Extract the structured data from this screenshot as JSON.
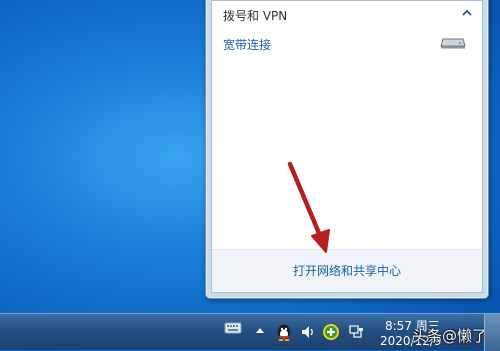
{
  "flyout": {
    "section_title": "拨号和 VPN",
    "connections": [
      {
        "label": "宽带连接",
        "icon": "modem-icon"
      }
    ],
    "footer_link": "打开网络和共享中心"
  },
  "taskbar": {
    "tray_icons": [
      "keyboard-icon",
      "show-hidden-icon",
      "qq-icon",
      "volume-icon",
      "green-icon",
      "network-icon"
    ],
    "clock_time": "8:57 周三",
    "clock_date": "2020/12/9"
  },
  "watermark": "头条@懒了",
  "colors": {
    "desktop": "#1a7fd8",
    "link": "#1e5fa8",
    "arrow": "#b51f1f"
  }
}
